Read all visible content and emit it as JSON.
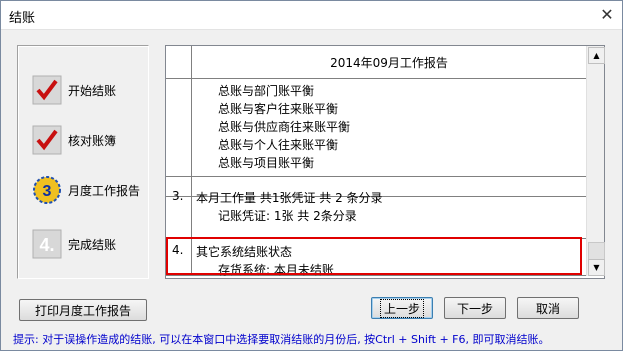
{
  "window": {
    "title": "结账"
  },
  "steps": [
    {
      "label": "开始结账",
      "icon": "checkmark-red-icon"
    },
    {
      "label": "核对账簿",
      "icon": "checkmark-red-icon"
    },
    {
      "label": "月度工作报告",
      "icon": "number-3-icon"
    },
    {
      "label": "完成结账",
      "icon": "number-4-gray-icon"
    }
  ],
  "report": {
    "title": "2014年09月工作报告",
    "lines": [
      {
        "num": "",
        "text": "总账与部门账平衡"
      },
      {
        "num": "",
        "text": "总账与客户往来账平衡"
      },
      {
        "num": "",
        "text": "总账与供应商往来账平衡"
      },
      {
        "num": "",
        "text": "总账与个人往来账平衡"
      },
      {
        "num": "",
        "text": "总账与项目账平衡"
      },
      {
        "num": "3.",
        "text": "本月工作量 共1张凭证 共 2 条分录"
      },
      {
        "num": "",
        "text": "记账凭证: 1张  共  2条分录"
      },
      {
        "num": "4.",
        "text": "其它系统结账状态"
      },
      {
        "num": "",
        "text": "存货系统: 本月未结账"
      }
    ]
  },
  "buttons": {
    "print": "打印月度工作报告",
    "prev": "上一步",
    "next": "下一步",
    "cancel": "取消"
  },
  "hint": "提示: 对于误操作造成的结账, 可以在本窗口中选择要取消结账的月份后, 按Ctrl + Shift + F6, 即可取消结账。"
}
